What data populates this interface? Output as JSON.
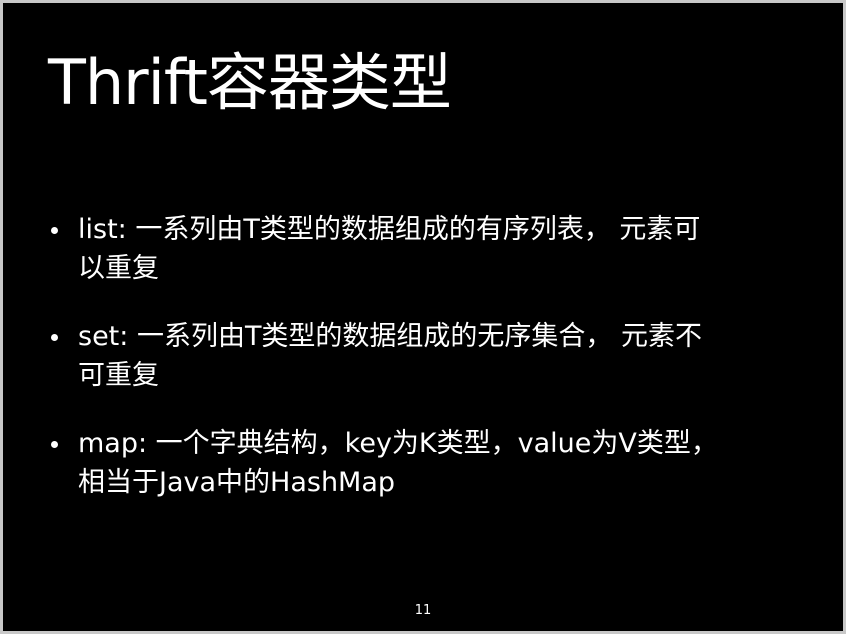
{
  "slide": {
    "title": "Thrift容器类型",
    "bullets": [
      {
        "text": "list: 一系列由T类型的数据组成的有序列表， 元素可\n以重复"
      },
      {
        "text": "set: 一系列由T类型的数据组成的无序集合， 元素不\n可重复"
      },
      {
        "text": "map: 一个字典结构，key为K类型，value为V类型，\n相当于Java中的HashMap"
      }
    ],
    "page_number": "11",
    "background_color": "#000000",
    "text_color": "#ffffff"
  }
}
